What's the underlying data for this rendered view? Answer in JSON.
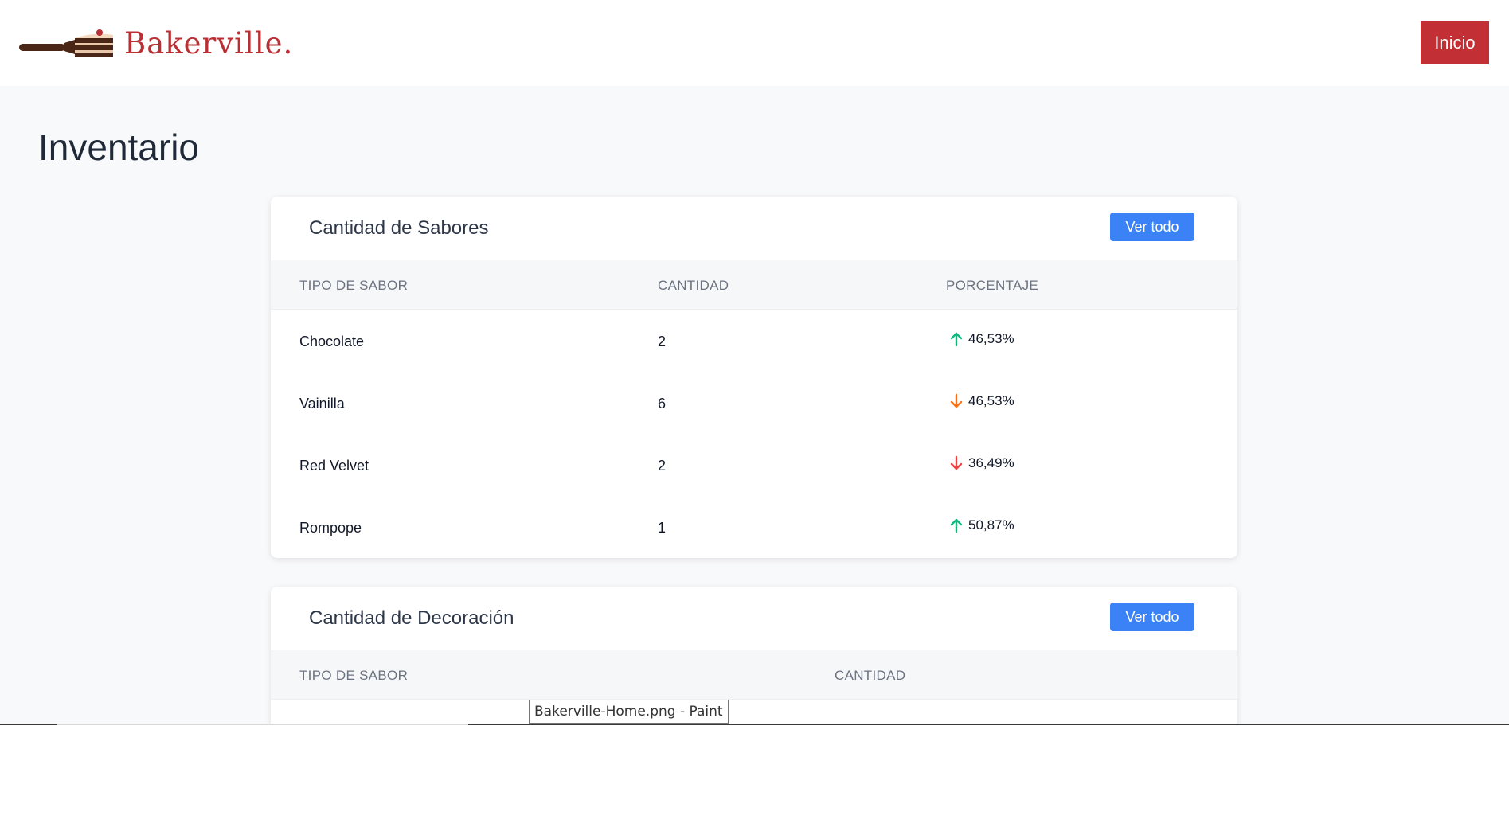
{
  "brand": {
    "name": "Bakerville."
  },
  "nav": {
    "home_label": "Inicio"
  },
  "page": {
    "title": "Inventario"
  },
  "flavors_card": {
    "title": "Cantidad de Sabores",
    "view_all_label": "Ver todo",
    "columns": [
      "TIPO DE SABOR",
      "CANTIDAD",
      "PORCENTAJE"
    ],
    "rows": [
      {
        "name": "Chocolate",
        "qty": "2",
        "pct": "46,53%",
        "trend": "up",
        "color": "#10b981"
      },
      {
        "name": "Vainilla",
        "qty": "6",
        "pct": "46,53%",
        "trend": "down",
        "color": "#f97316"
      },
      {
        "name": "Red Velvet",
        "qty": "2",
        "pct": "36,49%",
        "trend": "down",
        "color": "#ef4444"
      },
      {
        "name": "Rompope",
        "qty": "1",
        "pct": "50,87%",
        "trend": "up",
        "color": "#10b981"
      }
    ]
  },
  "decoration_card": {
    "title": "Cantidad de Decoración",
    "view_all_label": "Ver todo",
    "columns": [
      "TIPO DE SABOR",
      "CANTIDAD"
    ]
  },
  "taskbar": {
    "tooltip": "Bakerville-Home.png - Paint"
  },
  "colors": {
    "brand": "#b92f34",
    "button_blue": "#3b82f6",
    "nav_button": "#c22f35"
  }
}
